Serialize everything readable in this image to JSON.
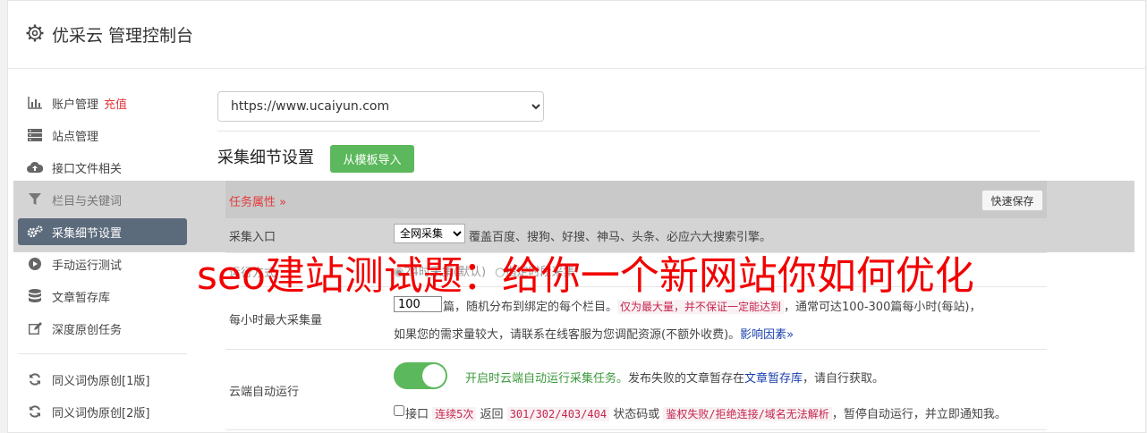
{
  "header": {
    "title": "优采云 管理控制台"
  },
  "sidebar": {
    "items": [
      {
        "label": "账户管理",
        "badge": "充值",
        "icon": "bar-chart-icon"
      },
      {
        "label": "站点管理",
        "icon": "server-icon"
      },
      {
        "label": "接口文件相关",
        "icon": "cloud-upload-icon"
      },
      {
        "label": "栏目与关键词",
        "icon": "filter-icon"
      },
      {
        "label": "采集细节设置",
        "icon": "gears-icon",
        "active": true
      },
      {
        "label": "手动运行测试",
        "icon": "play-circle-icon"
      },
      {
        "label": "文章暂存库",
        "icon": "database-icon"
      },
      {
        "label": "深度原创任务",
        "icon": "edit-icon"
      },
      {
        "label": "同义词伪原创[1版]",
        "icon": "refresh-icon"
      },
      {
        "label": "同义词伪原创[2版]",
        "icon": "refresh-icon"
      }
    ]
  },
  "main": {
    "site_select": {
      "value": "https://www.ucaiyun.com"
    },
    "section_title": "采集细节设置",
    "import_button": "从模板导入",
    "form_tab": "任务属性 »",
    "quick_save": "快速保存",
    "rows": {
      "entry": {
        "label": "采集入口",
        "select_value": "全网采集",
        "desc": "覆盖百度、搜狗、好搜、神马、头条、必应六大搜索引擎。"
      },
      "hidden_row": {
        "label": "运行方式",
        "option1": "24时采集(默认)",
        "option2": "指定时段采集"
      },
      "max": {
        "label": "每小时最大采集量",
        "value": "100",
        "text1": "篇，随机分布到绑定的每个栏目。",
        "pink1": "仅为最大量，并不保证一定能达到",
        "text2": "，通常可达100-300篇每小时(每站)，",
        "line2": "如果您的需求量较大，请联系在线客服为您调配资源(不额外收费)。",
        "link": "影响因素"
      },
      "cloud": {
        "label": "云端自动运行",
        "toggle_on": 1,
        "green_text": "开启时云端自动运行采集任务。",
        "text1": "发布失败的文章暂存在",
        "link": "文章暂存库",
        "text2": "，请自行获取。",
        "chk_label": "接口",
        "pink1": "连续5次",
        "text3": "返回",
        "pink2": "301/302/403/404",
        "text4": "状态码或",
        "pink3": "鉴权失败/拒绝连接/域名无法解析",
        "text5": "，暂停自动运行，并立即通知我。"
      }
    }
  },
  "watermark": "seo建站测试题：给你一个新网站你如何优化",
  "colors": {
    "accent_green": "#5cb85c",
    "nav_active": "#5c6b7c",
    "red": "#e4393c"
  }
}
